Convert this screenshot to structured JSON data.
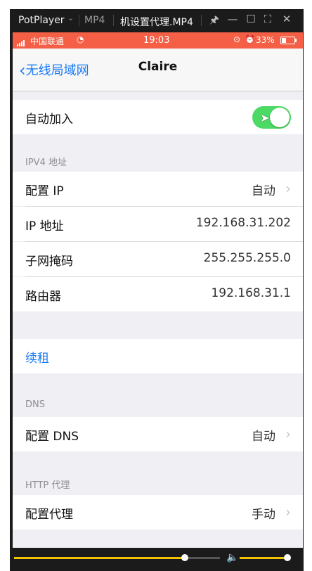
{
  "player": {
    "app_name": "PotPlayer",
    "format": "MP4",
    "file_title": "机设置代理.MP4"
  },
  "statusbar": {
    "carrier": "中国联通",
    "time": "19:03",
    "battery_text": "33%",
    "battery_level": 0.33
  },
  "navbar": {
    "back_label": "无线局域网",
    "title": "Claire"
  },
  "auto_join": {
    "label": "自动加入",
    "enabled": true
  },
  "ipv4": {
    "header": "IPV4 地址",
    "rows": [
      {
        "label": "配置 IP",
        "value": "自动"
      },
      {
        "label": "IP 地址",
        "value": "192.168.31.202"
      },
      {
        "label": "子网掩码",
        "value": "255.255.255.0"
      },
      {
        "label": "路由器",
        "value": "192.168.31.1"
      }
    ]
  },
  "renew_label": "续租",
  "dns": {
    "header": "DNS",
    "label": "配置 DNS",
    "value": "自动"
  },
  "http_proxy": {
    "header": "HTTP 代理",
    "label": "配置代理",
    "value": "手动"
  },
  "playback": {
    "seek_fraction": 0.83,
    "volume_fraction": 0.95
  },
  "colors": {
    "accent": "#1a7cf6",
    "toggle_on": "#4cd964",
    "statusbar": "#f45f45",
    "seek": "#f2c300"
  }
}
